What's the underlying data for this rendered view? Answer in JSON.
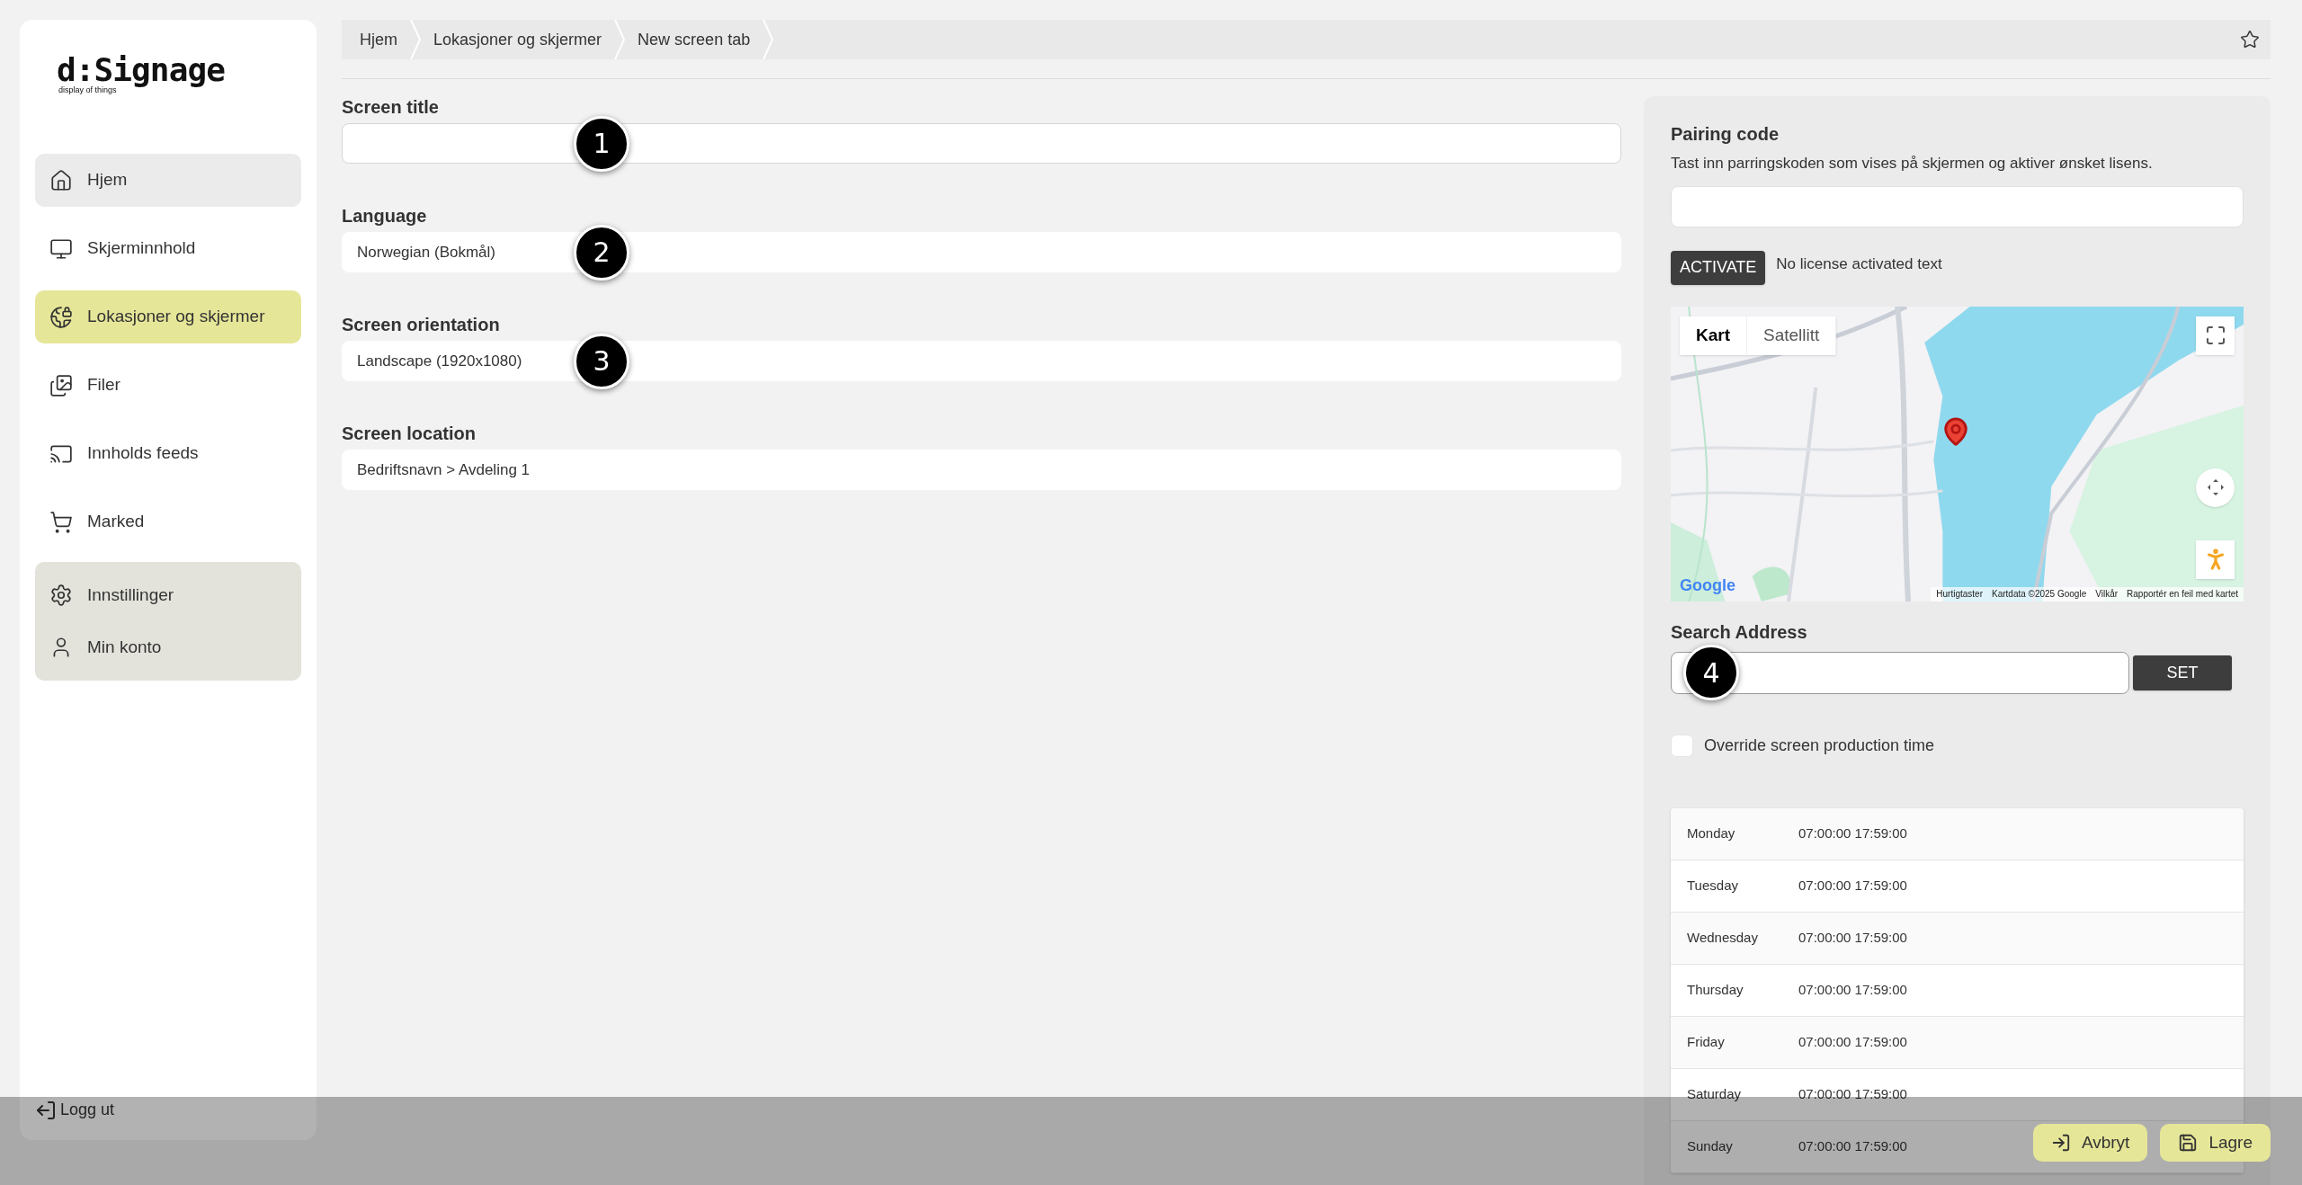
{
  "sidebar": {
    "logo": "d:Signage",
    "tagline": "display of things",
    "items": [
      {
        "label": "Hjem",
        "selected": false,
        "shaded": true
      },
      {
        "label": "Skjerminnhold",
        "selected": false,
        "shaded": false
      },
      {
        "label": "Lokasjoner og skjermer",
        "selected": true,
        "shaded": false
      },
      {
        "label": "Filer",
        "selected": false,
        "shaded": false
      },
      {
        "label": "Innholds feeds",
        "selected": false,
        "shaded": false
      },
      {
        "label": "Marked",
        "selected": false,
        "shaded": false
      }
    ],
    "settings_items": [
      {
        "label": "Innstillinger"
      },
      {
        "label": "Min konto"
      }
    ],
    "logout": "Logg ut"
  },
  "breadcrumbs": [
    "Hjem",
    "Lokasjoner og skjermer",
    "New screen tab"
  ],
  "form": {
    "fields": [
      {
        "label": "Screen title",
        "step_marker": "1",
        "bordered": true
      },
      {
        "label": "Language",
        "value": "Norwegian (Bokmål)",
        "step_marker": "2",
        "bordered": false
      },
      {
        "label": "Screen orientation",
        "value": "Landscape (1920x1080)",
        "step_marker": "3",
        "bordered": false
      },
      {
        "label": "Screen location",
        "value": "Bedriftsnavn > Avdeling 1",
        "bordered": false
      }
    ]
  },
  "pairing": {
    "label": "Pairing code",
    "description": "Tast inn parringskoden som vises på skjermen og aktiver ønsket lisens.",
    "button": "ACTIVATE",
    "status": "No license activated text"
  },
  "map": {
    "tabs": [
      {
        "label": "Kart",
        "selected": true
      },
      {
        "label": "Satellitt",
        "selected": false
      }
    ],
    "logo": "Google",
    "attribution": [
      "Hurtigtaster",
      "Kartdata ©2025 Google",
      "Vilkår",
      "Rapportér en feil med kartet"
    ]
  },
  "search_address": {
    "label": "Search Address",
    "step_marker": "4",
    "button": "SET"
  },
  "override": {
    "label": "Override screen production time",
    "checked": false
  },
  "schedule": [
    {
      "day": "Monday",
      "hours": "07:00:00 17:59:00"
    },
    {
      "day": "Tuesday",
      "hours": "07:00:00 17:59:00"
    },
    {
      "day": "Wednesday",
      "hours": "07:00:00 17:59:00"
    },
    {
      "day": "Thursday",
      "hours": "07:00:00 17:59:00"
    },
    {
      "day": "Friday",
      "hours": "07:00:00 17:59:00"
    },
    {
      "day": "Saturday",
      "hours": "07:00:00 17:59:00"
    },
    {
      "day": "Sunday",
      "hours": "07:00:00 17:59:00"
    }
  ],
  "footer_buttons": [
    {
      "label": "Avbryt"
    },
    {
      "label": "Lagre"
    }
  ]
}
